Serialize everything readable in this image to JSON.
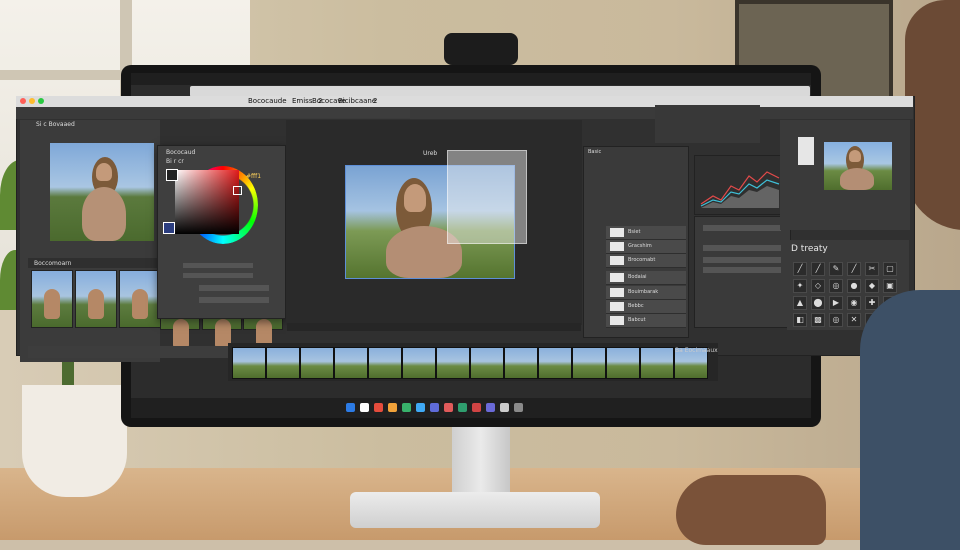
{
  "app": {
    "title_tabs": [
      "Bococaude",
      "Emiss",
      "Bococave",
      "2",
      "Bicibcaane",
      "2"
    ],
    "left_panel_title": "Si c Bovaaed",
    "filmstrip_title": "Boccomoarn",
    "picker_title": "Bococaud",
    "picker_sublabel": "Bi r cr",
    "hex_value": "#fff1",
    "canvas_label": "Ureb",
    "layers_title": "Basic",
    "layers": [
      "Bsiet",
      "Gracshim",
      "Brocomabt",
      "Bodaiai",
      "Bouimbarak",
      "Bebbc",
      "Babcut"
    ],
    "tools_title": "D treaty",
    "bottom_status": "Ba Eocimaaux"
  },
  "colors": {
    "accent_blue": "#5e8fd8",
    "close_red": "#ff5f57",
    "minimize_yellow": "#febc2e",
    "maximize_green": "#28c840"
  }
}
